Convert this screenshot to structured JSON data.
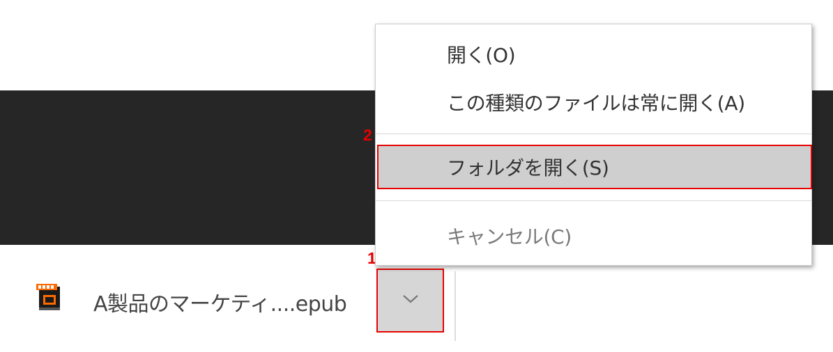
{
  "download": {
    "filename": "A製品のマーケティ....epub",
    "icon": "epub-file-icon"
  },
  "menu": {
    "items": [
      {
        "label": "開く(O)"
      },
      {
        "label": "この種類のファイルは常に開く(A)"
      },
      {
        "label": "フォルダを開く(S)"
      },
      {
        "label": "キャンセル(C)"
      }
    ]
  },
  "callouts": {
    "one": "1",
    "two": "2"
  },
  "colors": {
    "highlight_border": "#e60000",
    "dark_band": "#262626"
  }
}
